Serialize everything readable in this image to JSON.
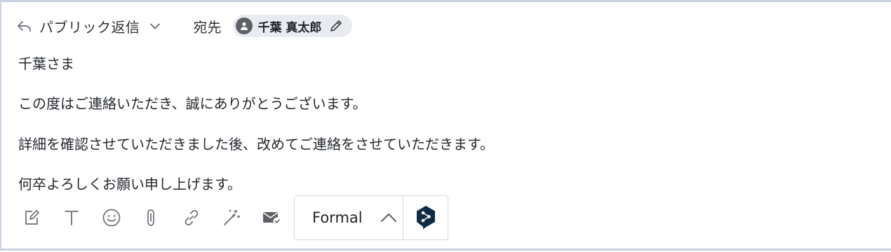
{
  "header": {
    "reply_type": "パブリック返信",
    "to_label": "宛先",
    "recipient": "千葉 真太郎"
  },
  "message": {
    "lines": [
      "千葉さま",
      "この度はご連絡いただき、誠にありがとうございます。",
      "詳細を確認させていただきました後、改めてご連絡をさせていただきます。",
      "何卒よろしくお願い申し上げます。"
    ]
  },
  "toolbar": {
    "icons": [
      "compose-icon",
      "text-format-icon",
      "emoji-icon",
      "attachment-icon",
      "link-icon",
      "magic-wand-icon",
      "mail-check-icon"
    ]
  },
  "tone": {
    "label": "Formal",
    "brand_icon": "deepl-icon"
  },
  "colors": {
    "border": "#c9d3e3",
    "chip_bg": "#e8ebf0",
    "deepl": "#0f2b46",
    "icon": "#6b7178"
  }
}
